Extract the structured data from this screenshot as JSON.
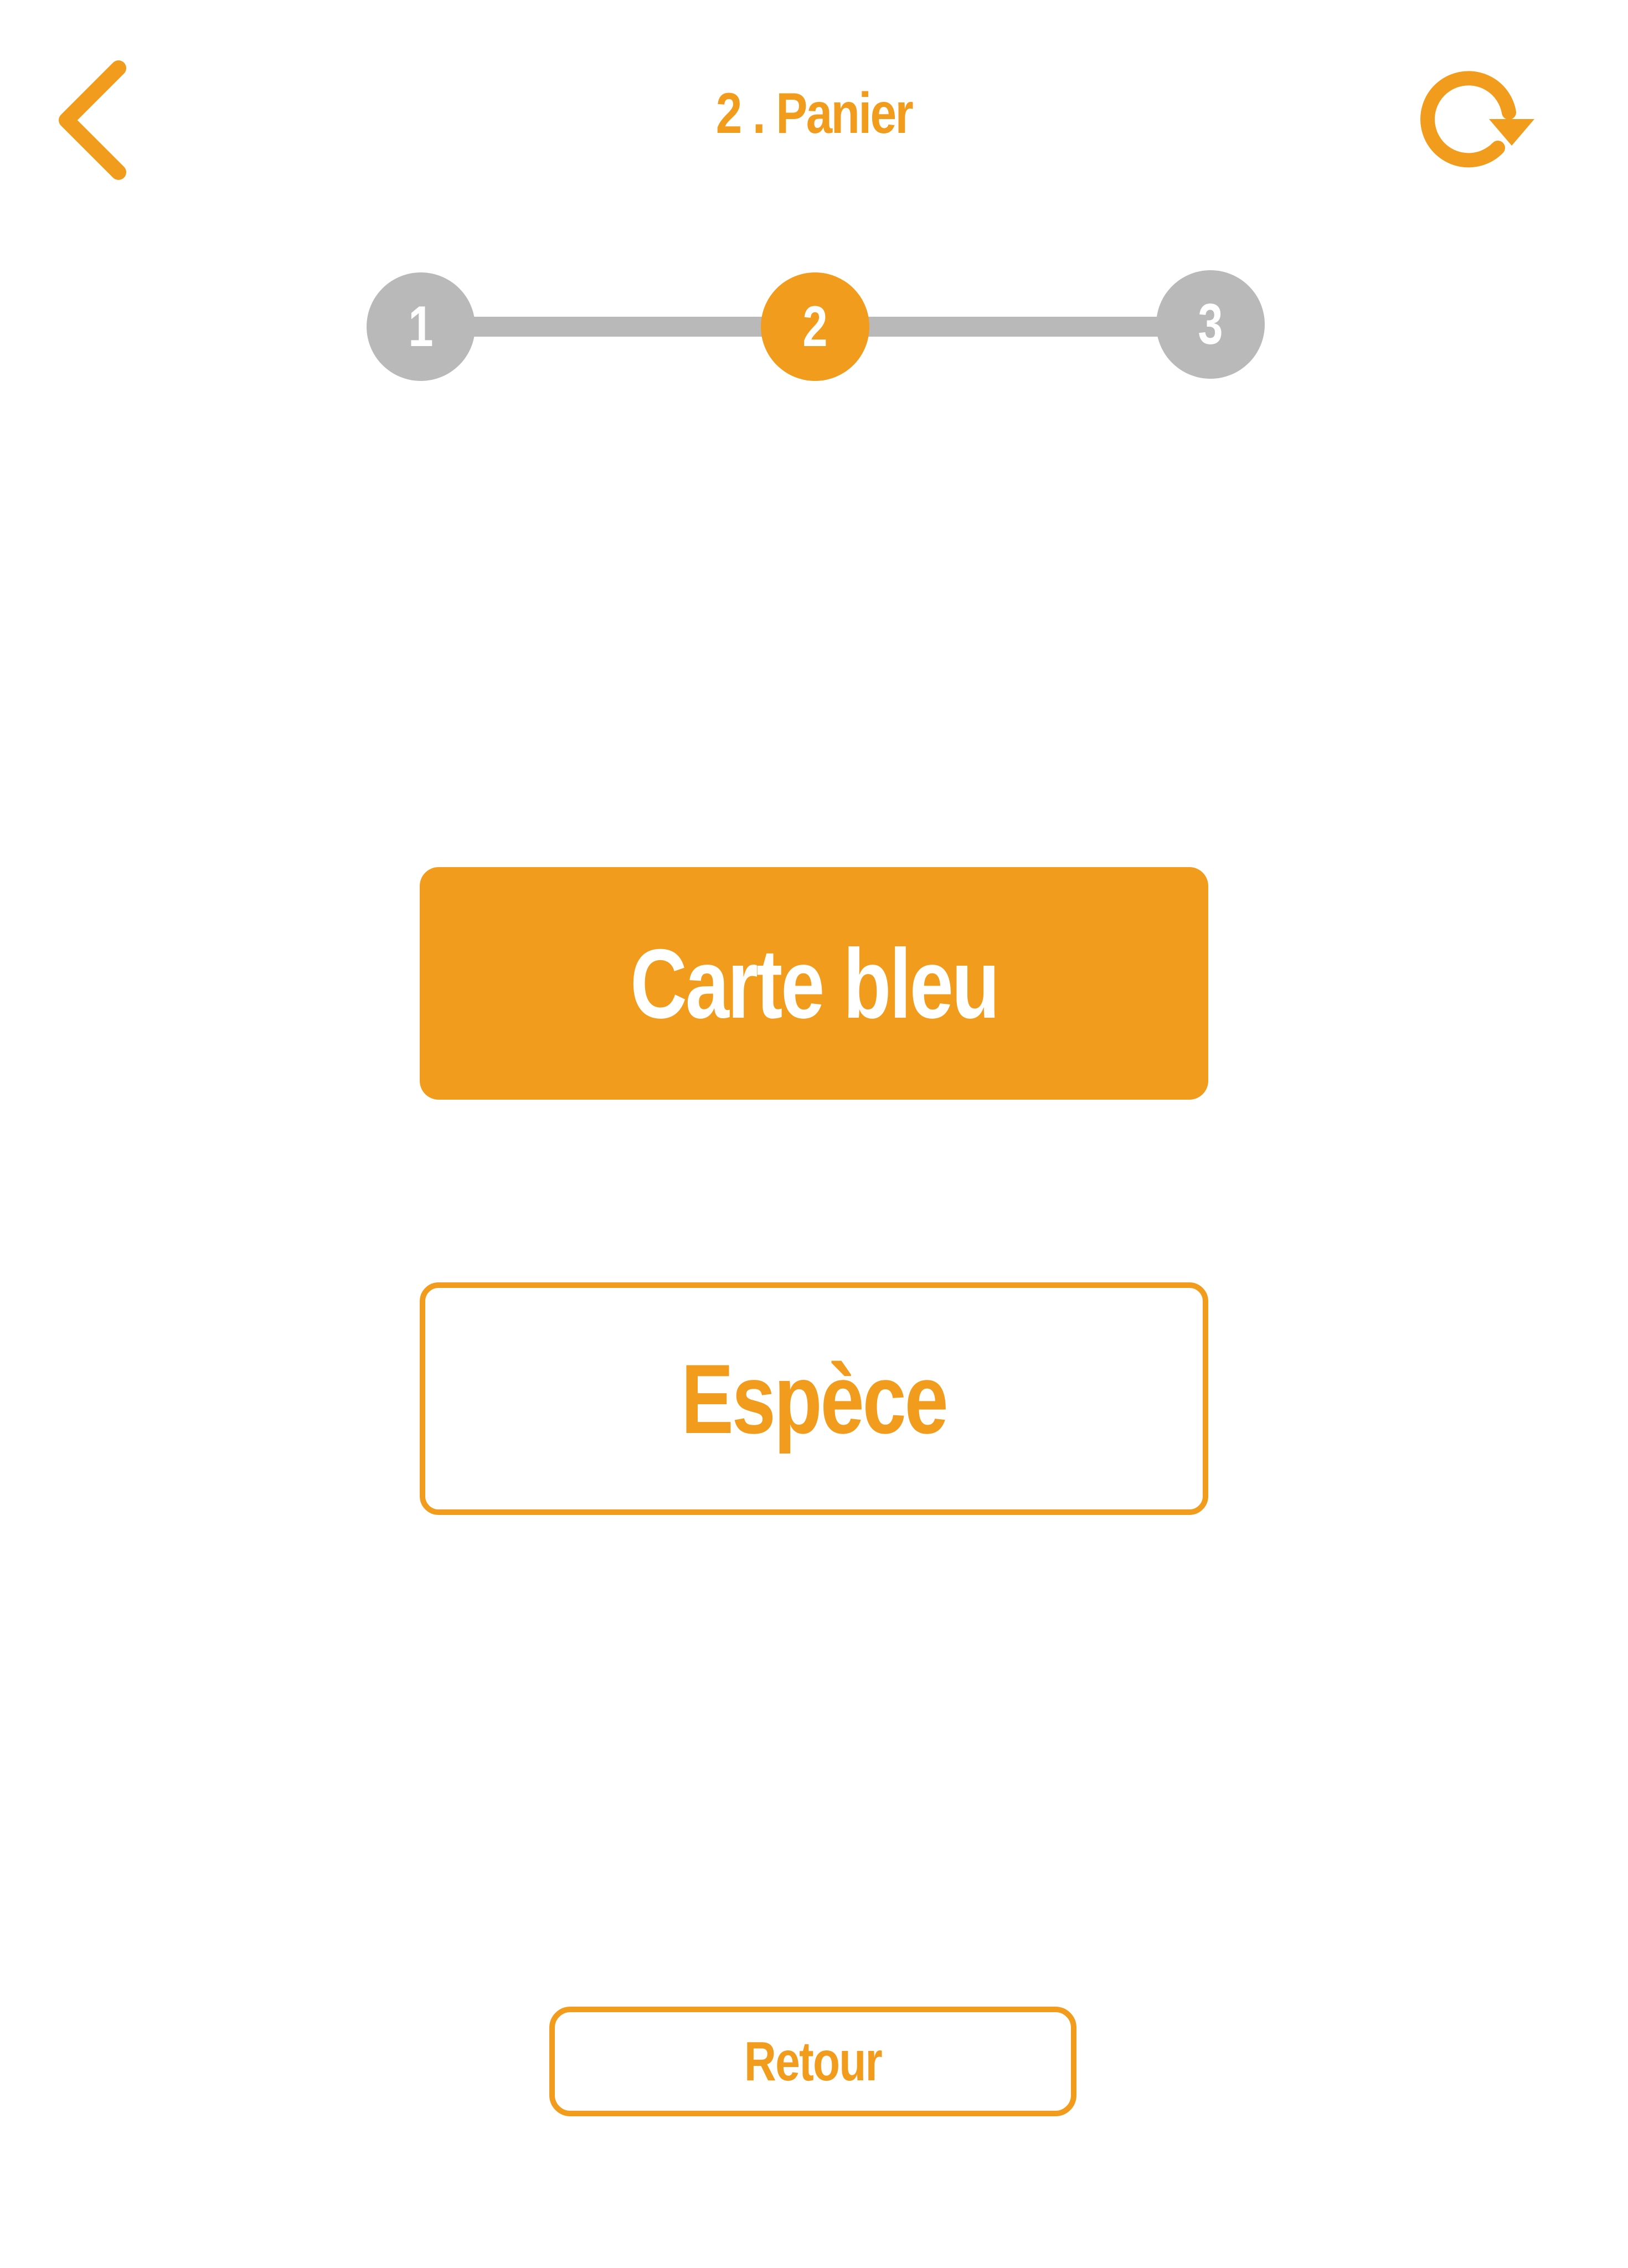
{
  "header": {
    "title": "2 . Panier",
    "back_icon": "chevron-left-icon",
    "refresh_icon": "refresh-icon"
  },
  "stepper": {
    "steps": [
      {
        "label": "1",
        "state": "inactive"
      },
      {
        "label": "2",
        "state": "active"
      },
      {
        "label": "3",
        "state": "inactive"
      }
    ],
    "current_step": 2
  },
  "payment": {
    "card_label": "Carte bleu",
    "cash_label": "Espèce"
  },
  "footer": {
    "back_label": "Retour"
  },
  "colors": {
    "accent": "#f29c1e",
    "inactive": "#b9b9b9",
    "background": "#ffffff"
  }
}
